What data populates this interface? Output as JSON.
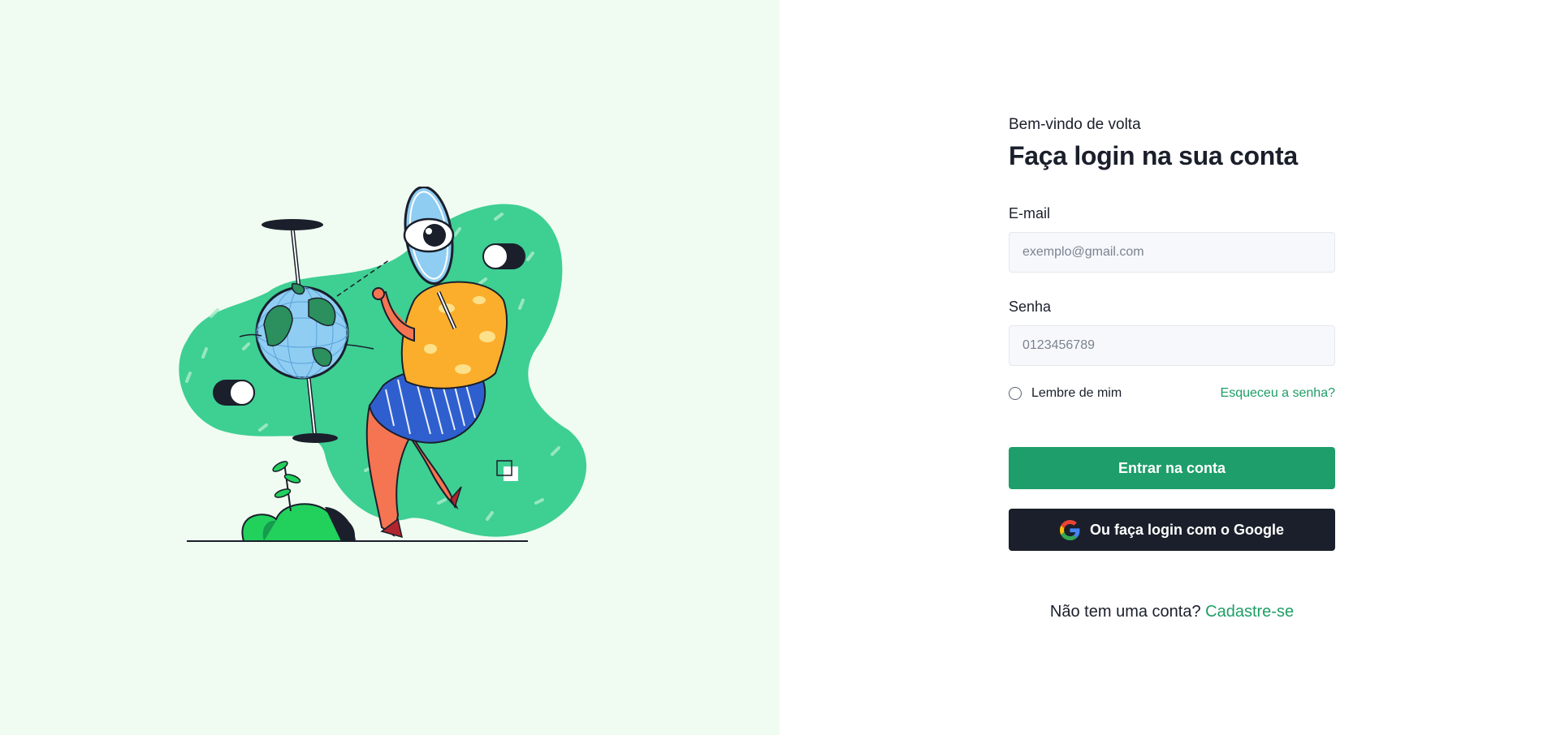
{
  "login": {
    "welcome": "Bem-vindo de volta",
    "heading": "Faça login na sua conta",
    "email": {
      "label": "E-mail",
      "placeholder": "exemplo@gmail.com",
      "value": ""
    },
    "password": {
      "label": "Senha",
      "placeholder": "0123456789",
      "value": ""
    },
    "remember_label": "Lembre de mim",
    "remember_checked": false,
    "forgot_link": "Esqueceu a senha?",
    "submit_label": "Entrar na conta",
    "google_label": "Ou faça login com o Google",
    "signup_prompt": "Não tem uma conta?",
    "signup_link": "Cadastre-se"
  },
  "colors": {
    "left_background": "#f0fcf1",
    "accent_green": "#1e9e6a",
    "link_green": "#1e9e65",
    "dark_button": "#1a1f2b",
    "input_background": "#f6f8fb",
    "illustration_blob": "#3ecf93"
  },
  "icons": {
    "google": "google-g-icon",
    "illustration": "person-magnifier-globe-illustration"
  }
}
